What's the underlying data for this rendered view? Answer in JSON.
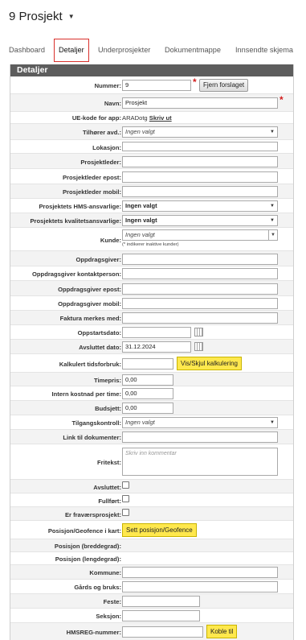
{
  "page": {
    "title": "9 Prosjekt"
  },
  "tabs": [
    {
      "label": "Dashboard"
    },
    {
      "label": "Detaljer"
    },
    {
      "label": "Underprosjekter"
    },
    {
      "label": "Dokumentmappe"
    },
    {
      "label": "Innsendte skjema"
    }
  ],
  "panel": {
    "header": "Detaljer"
  },
  "fields": {
    "nummer": {
      "label": "Nummer:",
      "value": "9",
      "button": "Fjern forslaget"
    },
    "navn": {
      "label": "Navn:",
      "value": "Prosjekt"
    },
    "uekode": {
      "label": "UE-kode for app:",
      "value": "ARADotg",
      "link": "Skriv ut"
    },
    "avd": {
      "label": "Tilhører avd.:",
      "value": "Ingen valgt"
    },
    "lokasjon": {
      "label": "Lokasjon:",
      "value": ""
    },
    "prosjektleder": {
      "label": "Prosjektleder:",
      "value": ""
    },
    "pl_epost": {
      "label": "Prosjektleder epost:",
      "value": ""
    },
    "pl_mobil": {
      "label": "Prosjektleder mobil:",
      "value": ""
    },
    "hms": {
      "label": "Prosjektets HMS-ansvarlige:",
      "value": "Ingen valgt"
    },
    "kvalitet": {
      "label": "Prosjektets kvalitetsansvarlige:",
      "value": "Ingen valgt"
    },
    "kunde": {
      "label": "Kunde:",
      "value": "Ingen valgt",
      "note": "(* indikerer inaktive kunder)"
    },
    "oppdragsgiver": {
      "label": "Oppdragsgiver:",
      "value": ""
    },
    "og_kontakt": {
      "label": "Oppdragsgiver kontaktperson:",
      "value": ""
    },
    "og_epost": {
      "label": "Oppdragsgiver epost:",
      "value": ""
    },
    "og_mobil": {
      "label": "Oppdragsgiver mobil:",
      "value": ""
    },
    "faktura": {
      "label": "Faktura merkes med:",
      "value": ""
    },
    "oppstart": {
      "label": "Oppstartsdato:",
      "value": ""
    },
    "avsluttet_dato": {
      "label": "Avsluttet dato:",
      "value": "31.12.2024"
    },
    "kalkulert": {
      "label": "Kalkulert tidsforbruk:",
      "value": "",
      "button": "Vis/Skjul kalkulering"
    },
    "timepris": {
      "label": "Timepris:",
      "value": "0,00"
    },
    "intern": {
      "label": "Intern kostnad per time:",
      "value": "0,00"
    },
    "budsjett": {
      "label": "Budsjett:",
      "value": "0,00"
    },
    "tilgang": {
      "label": "Tilgangskontroll:",
      "value": "Ingen valgt"
    },
    "link": {
      "label": "Link til dokumenter:",
      "value": ""
    },
    "fritekst": {
      "label": "Fritekst:",
      "placeholder": "Skriv inn kommentar"
    },
    "avsluttet": {
      "label": "Avsluttet:"
    },
    "fullfort": {
      "label": "Fullført:"
    },
    "fravaer": {
      "label": "Er fraværsprosjekt:"
    },
    "posisjon": {
      "label": "Posisjon/Geofence i kart:",
      "button": "Sett posisjon/Geofence"
    },
    "breddegrad": {
      "label": "Posisjon (breddegrad):"
    },
    "lengdegrad": {
      "label": "Posisjon (lengdegrad):"
    },
    "kommune": {
      "label": "Kommune:",
      "value": ""
    },
    "gards": {
      "label": "Gårds og bruks:",
      "value": ""
    },
    "feste": {
      "label": "Feste:",
      "value": ""
    },
    "seksjon": {
      "label": "Seksjon:",
      "value": ""
    },
    "hmsreg": {
      "label": "HMSREG-nummer:",
      "value": "",
      "button": "Koble til"
    }
  },
  "icons": {
    "dropdown": "caret-down-icon",
    "calendar": "calendar-icon",
    "required": "asterisk-icon"
  },
  "colors": {
    "header_bg": "#5d5d5d",
    "active_tab_border": "#d9302b",
    "yellow_button": "#ffe84d",
    "required": "#d21d1d"
  }
}
